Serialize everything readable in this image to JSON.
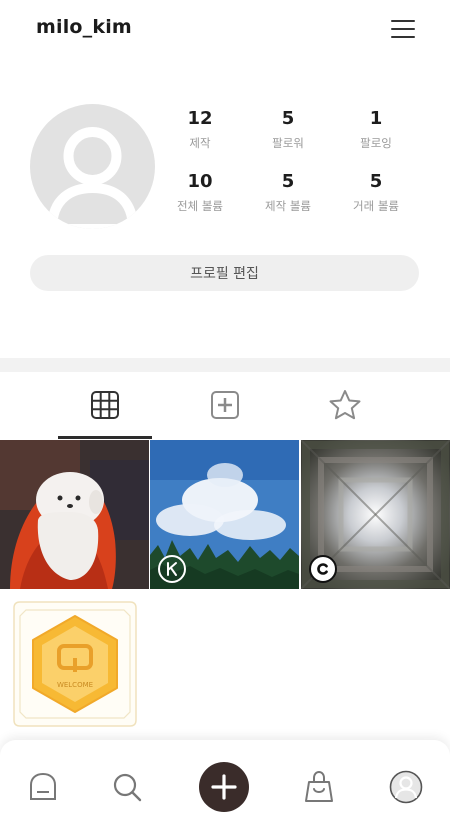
{
  "header": {
    "username": "milo_kim",
    "menu_icon": "hamburger-menu-icon"
  },
  "profile": {
    "avatar_icon": "default-user-avatar-icon",
    "stats": [
      {
        "value": "12",
        "label": "제작"
      },
      {
        "value": "5",
        "label": "팔로워"
      },
      {
        "value": "1",
        "label": "팔로잉"
      },
      {
        "value": "10",
        "label": "전체 볼륨"
      },
      {
        "value": "5",
        "label": "제작 볼륨"
      },
      {
        "value": "5",
        "label": "거래 볼륨"
      }
    ],
    "edit_button": "프로필 편집"
  },
  "tabs": [
    {
      "icon": "grid-icon",
      "active": true
    },
    {
      "icon": "plus-square-icon",
      "active": false
    },
    {
      "icon": "star-icon",
      "active": false
    }
  ],
  "gallery": {
    "items": [
      {
        "image": "white-puppy-painting",
        "badge": "none"
      },
      {
        "image": "sky-clouds-painting",
        "badge": "k-logo-badge"
      },
      {
        "image": "city-kaleidoscope-photo",
        "badge": "copyright-badge"
      },
      {
        "image": "welcome-hexagon-badge",
        "badge": "none"
      }
    ],
    "welcome_text": "WELCOME"
  },
  "bottom_nav": {
    "items": [
      "home-icon",
      "search-icon",
      "add-icon",
      "shopping-bag-icon",
      "profile-icon"
    ],
    "accent": "#3a2c2a"
  }
}
